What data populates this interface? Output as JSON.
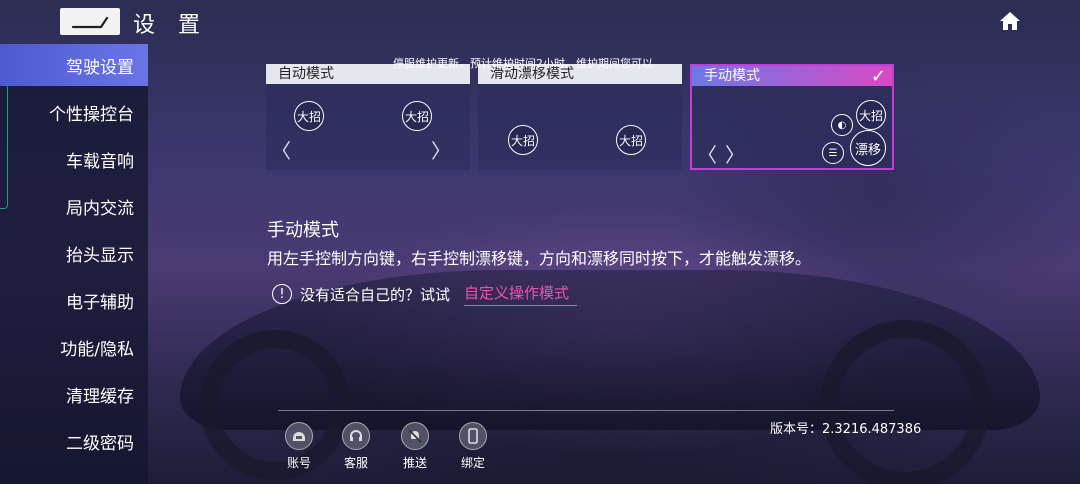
{
  "header": {
    "title": "设 置"
  },
  "sidebar": {
    "items": [
      {
        "label": "驾驶设置",
        "active": true
      },
      {
        "label": "个性操控台"
      },
      {
        "label": "车载音响"
      },
      {
        "label": "局内交流"
      },
      {
        "label": "抬头显示"
      },
      {
        "label": "电子辅助"
      },
      {
        "label": "功能/隐私"
      },
      {
        "label": "清理缓存"
      },
      {
        "label": "二级密码"
      }
    ]
  },
  "notice": "停服维护更新，预计维护时间2小时。维护期间您可以",
  "modes": [
    {
      "title": "自动模式",
      "buttons": [
        "大招",
        "大招"
      ]
    },
    {
      "title": "滑动漂移模式",
      "buttons": [
        "大招",
        "大招"
      ]
    },
    {
      "title": "手动模式",
      "buttons": [
        "大招",
        "漂移"
      ],
      "selected": true
    }
  ],
  "description": {
    "title": "手动模式",
    "text": "用左手控制方向键，右手控制漂移键，方向和漂移同时按下，才能触发漂移。",
    "hint": "没有适合自己的？试试",
    "link": "自定义操作模式"
  },
  "version": "版本号：2.3216.487386",
  "bottom": [
    {
      "label": "账号",
      "icon": "helmet-icon"
    },
    {
      "label": "客服",
      "icon": "headset-icon"
    },
    {
      "label": "推送",
      "icon": "bell-muted-icon"
    },
    {
      "label": "绑定",
      "icon": "phone-icon"
    }
  ],
  "colors": {
    "accent": "#6b74e6",
    "link": "#ef52b2",
    "selected_border": "#c13fd8"
  }
}
